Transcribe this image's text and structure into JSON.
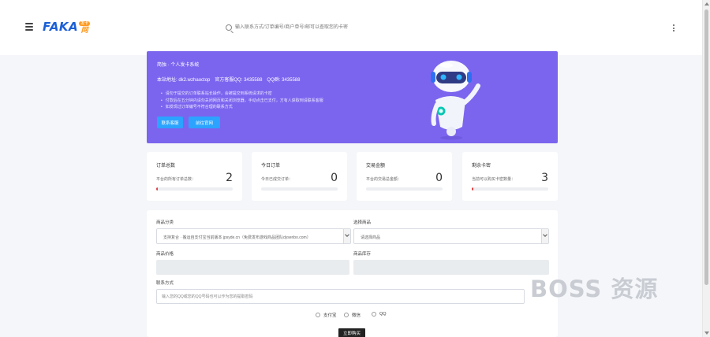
{
  "header": {
    "logo_main": "FAKA",
    "logo_badge": "发卡",
    "logo_sub": "网",
    "search_placeholder": "输入联系方式/订单编号/商户单号/邮可以查取您的卡密",
    "menu_icon": "menu-icon",
    "more_icon": "more-vertical-icon"
  },
  "banner": {
    "title": "简独 · 个人发卡系统",
    "site_label": "本站地址:",
    "site_value": "dk2.wzhaoctop",
    "qq_label": "官方客服QQ:",
    "qq_value": "3435588",
    "group_label": "QQ群:",
    "group_value": "3435588",
    "bullets": [
      "请勿于提交的订单联系站长操作，会被提交到系统请求的卡密",
      "付款后在五分钟内请勿关闭网页和关闭浏览器，手动点击已支付，方有人获取到请联系客服",
      "如发现过订单编号不符合理的联系方式"
    ],
    "contact_button": "联系客服",
    "official_button": "前往官网",
    "background_color": "#7b65ef",
    "button_color": "#2ba3ff"
  },
  "stats": [
    {
      "title": "订单总数",
      "label": "平台的所有订单总数：",
      "value": "2",
      "progress": 0.02
    },
    {
      "title": "今日订单",
      "label": "今日已成交订单：",
      "value": "0",
      "progress": 0
    },
    {
      "title": "交易金额",
      "label": "平台的交易总金额：",
      "value": "0",
      "progress": 0
    },
    {
      "title": "剩余卡密",
      "label": "当前可以购买卡密数量：",
      "value": "3",
      "progress": 0.02
    }
  ],
  "form": {
    "category_label": "商品分类",
    "category_value": "支持复合 · 搬运自支付宝当前版本 jpsyde.cn（免费发布游戏商品团队dysenbo.com）",
    "product_label": "选择商品",
    "product_value": "请选择商品",
    "price_label": "商品价格",
    "stock_label": "商品库存",
    "contact_label": "联系方式",
    "contact_placeholder": "输入您的QQ或您的QQ号码也可以作为您的提取密码",
    "payments": [
      "支付宝",
      "微信",
      "QQ"
    ],
    "buy_button": "立即购买"
  },
  "watermark": "BOSS 资源"
}
